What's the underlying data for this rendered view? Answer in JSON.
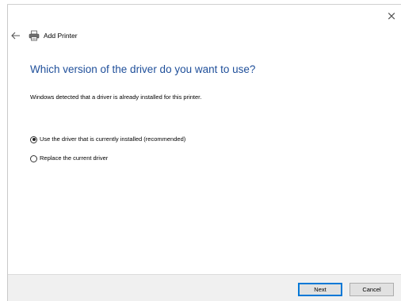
{
  "window": {
    "close_glyph": "×"
  },
  "header": {
    "back_icon": "arrow-left-icon",
    "app_icon": "printer-icon",
    "title": "Add Printer"
  },
  "main": {
    "heading": "Which version of the driver do you want to use?",
    "description": "Windows detected that a driver is already installed for this printer.",
    "options": [
      {
        "label": "Use the driver that is currently installed (recommended)",
        "selected": true
      },
      {
        "label": "Replace the current driver",
        "selected": false
      }
    ]
  },
  "footer": {
    "next_label": "Next",
    "cancel_label": "Cancel"
  },
  "colors": {
    "heading": "#1f4f9a",
    "default_button_border": "#0078d7",
    "footer_background": "#f0f0f0"
  }
}
